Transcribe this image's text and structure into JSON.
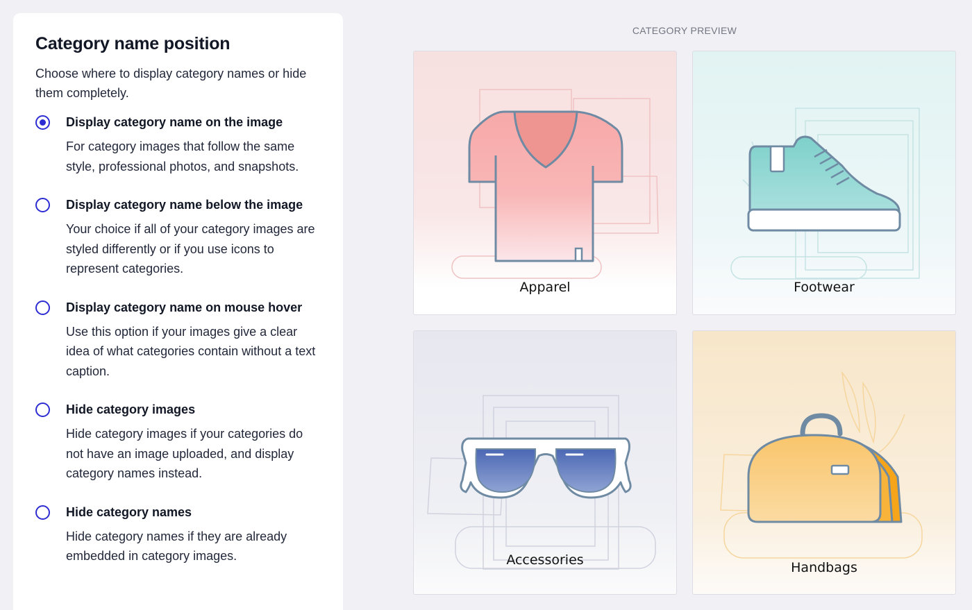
{
  "settings": {
    "title": "Category name position",
    "description": "Choose where to display category names or hide them completely.",
    "selected_index": 0,
    "options": [
      {
        "title": "Display category name on the image",
        "description": "For category images that follow the same style, professional photos, and snapshots."
      },
      {
        "title": "Display category name below the image",
        "description": "Your choice if all of your category images are styled differently or if you use icons to represent categories."
      },
      {
        "title": "Display category name on mouse hover",
        "description": "Use this option if your images give a clear idea of what categories contain without a text caption."
      },
      {
        "title": "Hide category images",
        "description": "Hide category images if your categories do not have an image uploaded, and display category names instead."
      },
      {
        "title": "Hide category names",
        "description": "Hide category names if they are already embedded in category images."
      }
    ]
  },
  "preview": {
    "label": "CATEGORY PREVIEW",
    "cards": [
      {
        "name": "Apparel",
        "icon": "t-shirt-icon"
      },
      {
        "name": "Footwear",
        "icon": "sneaker-icon"
      },
      {
        "name": "Accessories",
        "icon": "sunglasses-icon"
      },
      {
        "name": "Handbags",
        "icon": "handbag-icon"
      }
    ]
  },
  "colors": {
    "accent": "#2d2cd3",
    "outline": "#6f8aa3"
  }
}
